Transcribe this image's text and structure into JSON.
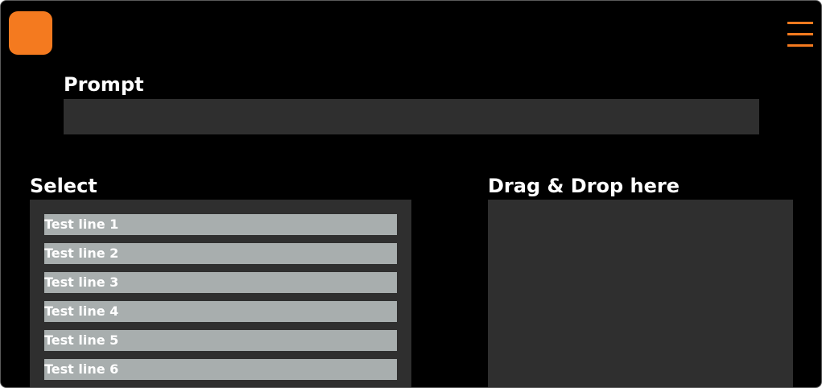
{
  "prompt": {
    "label": "Prompt",
    "value": "",
    "placeholder": ""
  },
  "select": {
    "label": "Select",
    "options": [
      "Test line 1",
      "Test line 2",
      "Test line 3",
      "Test line 4",
      "Test line 5",
      "Test line 6"
    ]
  },
  "dropzone": {
    "label": "Drag & Drop here"
  },
  "icons": {
    "logo": "logo-square",
    "menu": "hamburger-menu-icon"
  },
  "colors": {
    "background": "#000000",
    "accent": "#f47a1f",
    "panel": "#2f2f2f",
    "option": "#a8aeae",
    "text": "#ffffff"
  }
}
